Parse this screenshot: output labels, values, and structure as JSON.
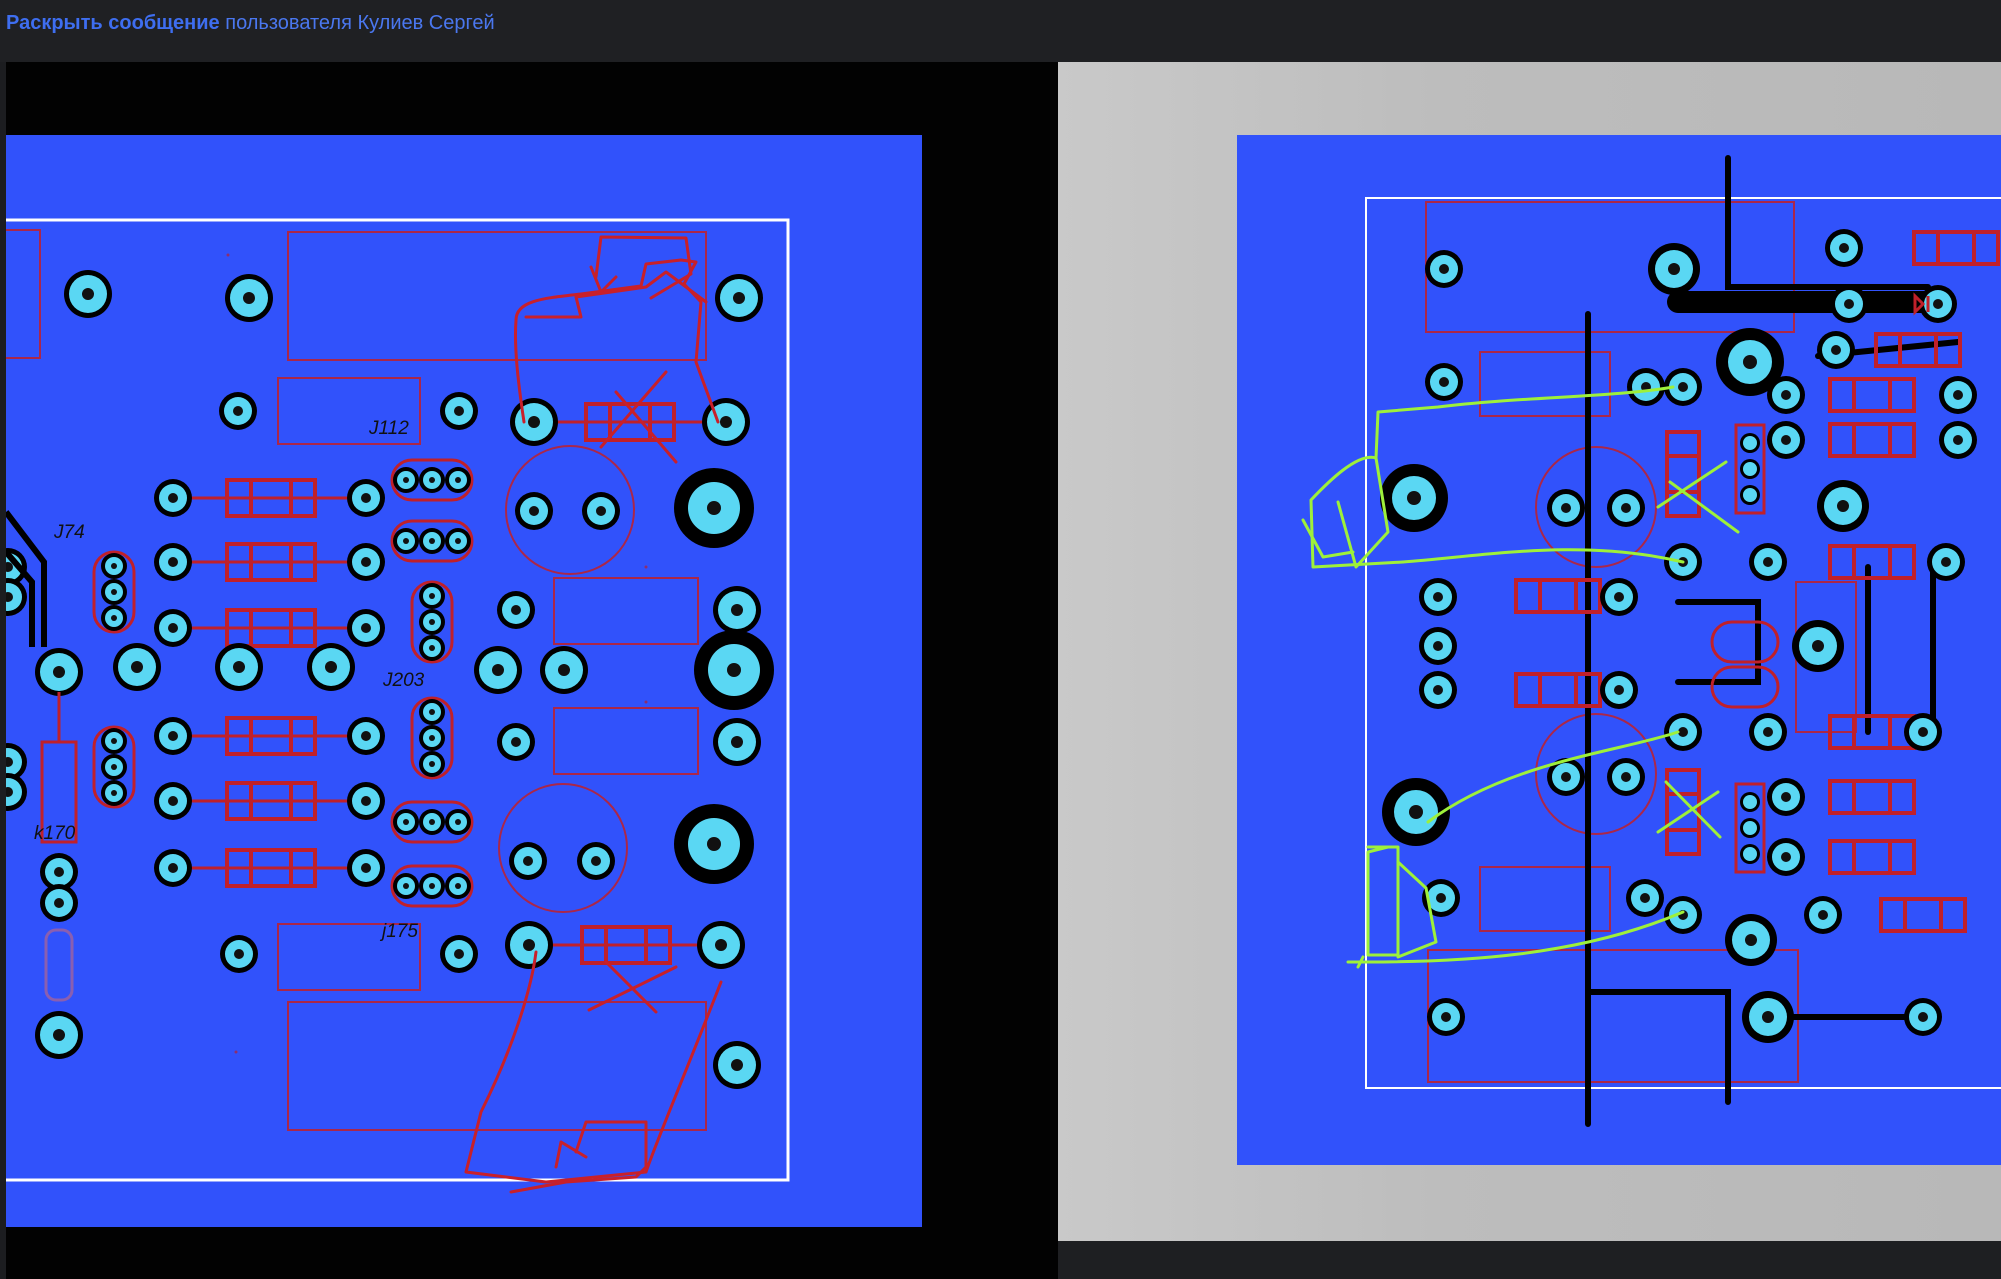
{
  "header": {
    "reveal_link": "Раскрыть сообщение",
    "reveal_rest": " пользователя Кулиев Сергей"
  },
  "left_board": {
    "labels": [
      "J112",
      "J74",
      "J203",
      "k170",
      "j175"
    ]
  },
  "colors": {
    "board": "#3152fb",
    "pad": "#5ad7f3",
    "trace": "#c0202a",
    "annotation_right": "#9ef03a",
    "outline": "#ffffff"
  }
}
